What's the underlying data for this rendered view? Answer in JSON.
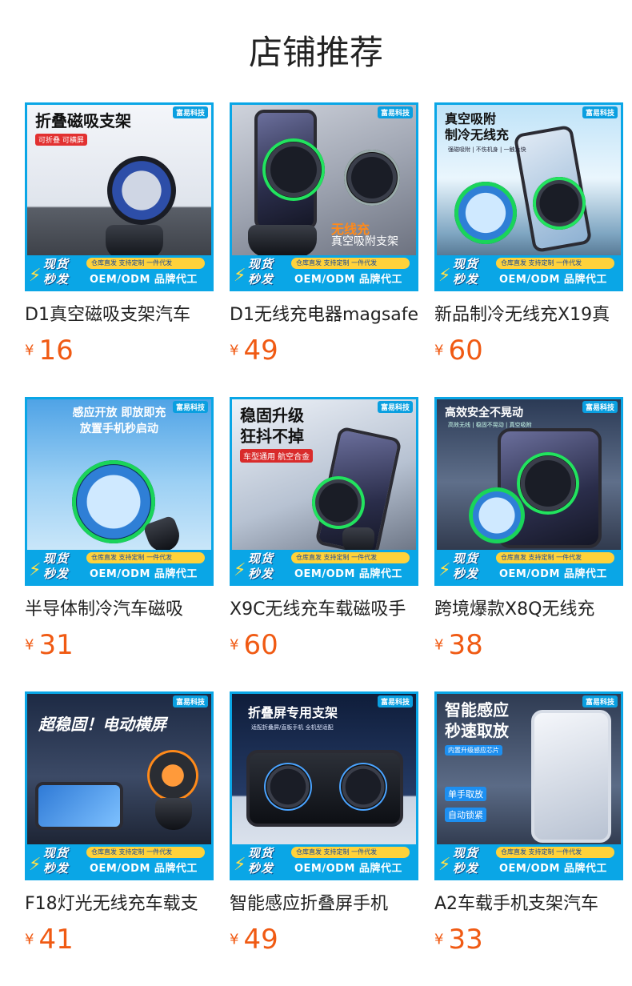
{
  "page_title": "店铺推荐",
  "currency_symbol": "¥",
  "brand_badge": "富易科技",
  "banner": {
    "line1": "现货",
    "line2": "秒发",
    "chips": "仓库直发  支持定制  一件代发",
    "oem": "OEM/ODM 品牌代工"
  },
  "products": [
    {
      "name": "D1真空磁吸支架汽车",
      "price": "16",
      "headline": "折叠磁吸支架",
      "tag": "可折叠 可横屏"
    },
    {
      "name": "D1无线充电器magsafe",
      "price": "49",
      "headline": "",
      "tag": "",
      "caption1": "无线充",
      "caption2": "真空吸附支架"
    },
    {
      "name": "新品制冷无线充X19真",
      "price": "60",
      "headline": "真空吸附",
      "headline2": "制冷无线充",
      "tag": "强磁吸附 | 不伤机身 | 一触急快"
    },
    {
      "name": "半导体制冷汽车磁吸",
      "price": "31",
      "headline": "感应开放 即放即充",
      "headline2": "放置手机秒启动",
      "tag": ""
    },
    {
      "name": "X9C无线充车载磁吸手",
      "price": "60",
      "headline": "稳固升级",
      "headline2": "狂抖不掉",
      "tag": "车型通用 航空合金"
    },
    {
      "name": "跨境爆款X8Q无线充",
      "price": "38",
      "headline": "高效安全不晃动",
      "tag": "高效无线 | 稳固不晃动 | 真空吸附"
    },
    {
      "name": "F18灯光无线充车载支",
      "price": "41",
      "headline": "超稳固！电动横屏",
      "tag": ""
    },
    {
      "name": "智能感应折叠屏手机",
      "price": "49",
      "headline": "折叠屏专用支架",
      "tag": "适配折叠屏/直板手机 全机型适配"
    },
    {
      "name": "A2车载手机支架汽车",
      "price": "33",
      "headline": "智能感应",
      "headline2": "秒速取放",
      "tag": "内置升级感应芯片",
      "btn1": "单手取放",
      "btn2": "自动锁紧"
    }
  ],
  "colors": {
    "accent": "#0aa6e6",
    "price": "#f05a13",
    "banner_yellow": "#ffd23a"
  }
}
